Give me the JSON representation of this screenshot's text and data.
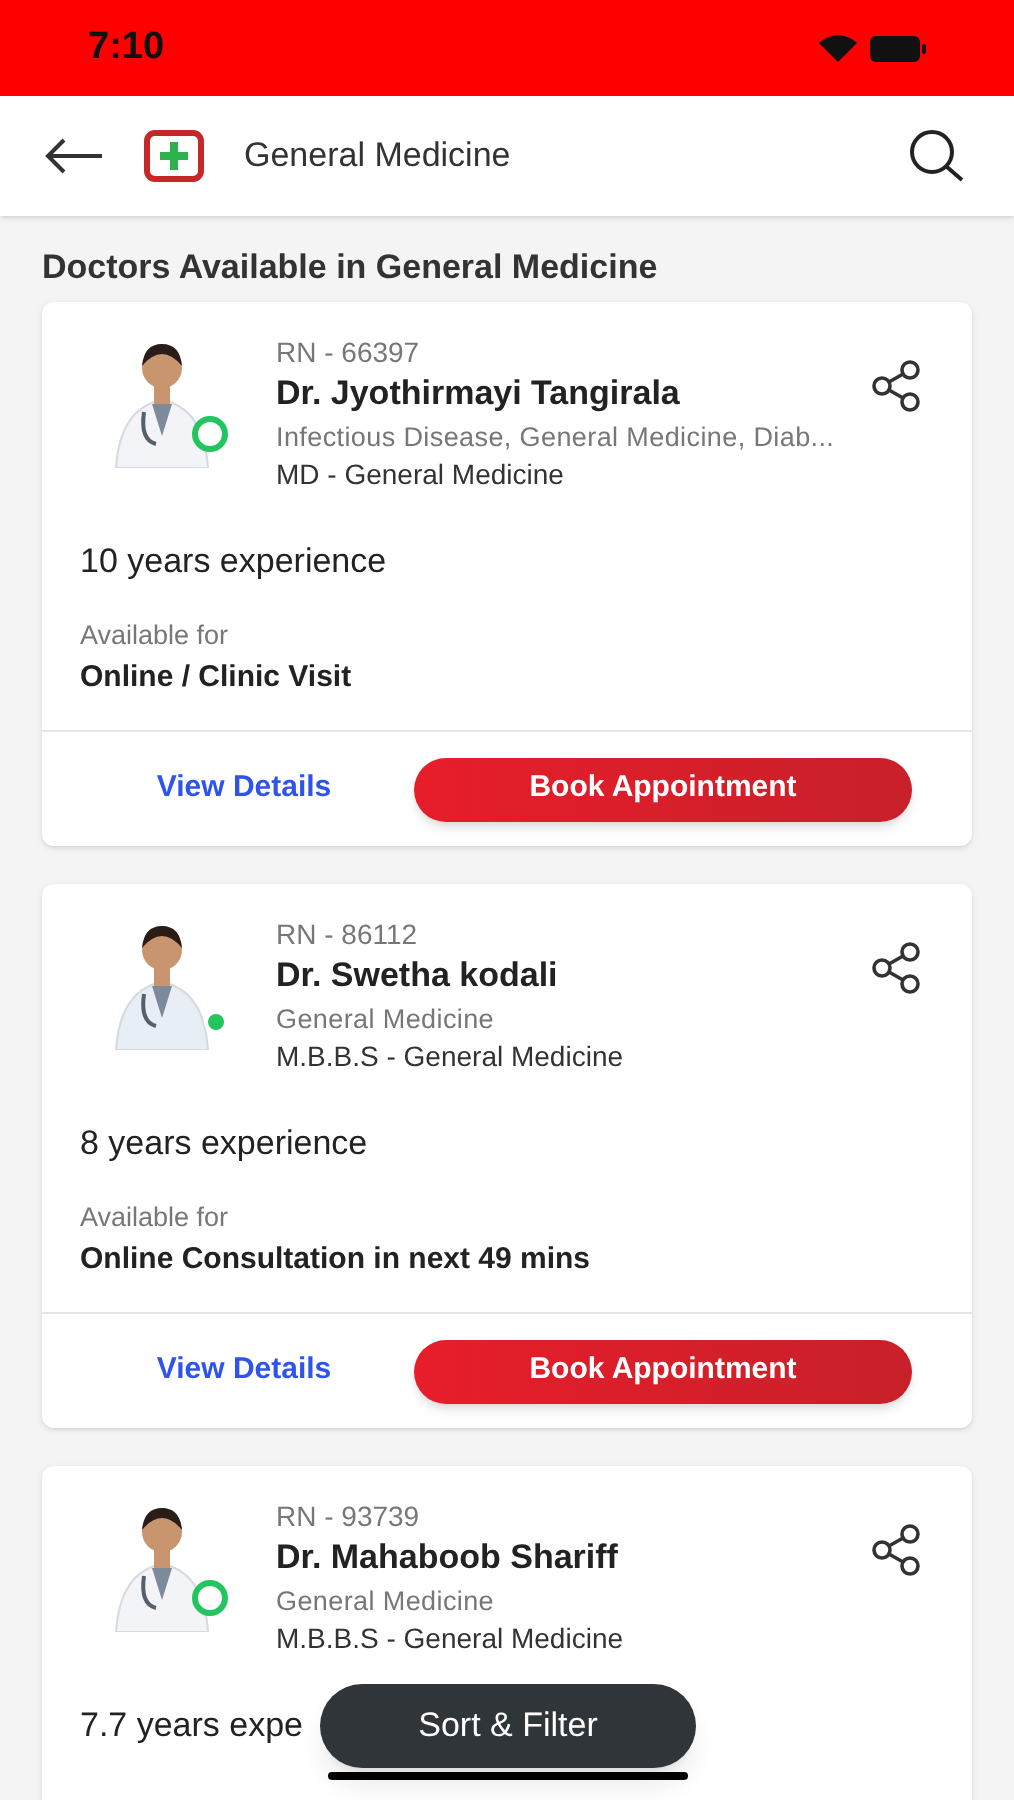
{
  "status_bar": {
    "time": "7:10"
  },
  "header": {
    "title": "General Medicine"
  },
  "section_title": "Doctors Available in General Medicine",
  "doctors": [
    {
      "rn": "RN - 66397",
      "name": "Dr. Jyothirmayi Tangirala",
      "specialities": "Infectious Disease, General Medicine, Diab...",
      "degree": "MD - General Medicine",
      "experience": "10 years experience",
      "available_label": "Available for",
      "available": "Online / Clinic Visit",
      "indicator_filled": false,
      "view_label": "View Details",
      "book_label": "Book Appointment"
    },
    {
      "rn": "RN - 86112",
      "name": "Dr. Swetha kodali",
      "specialities": "General Medicine",
      "degree": "M.B.B.S - General Medicine",
      "experience": "8 years experience",
      "available_label": "Available for",
      "available": "Online Consultation in next 49 mins",
      "indicator_filled": true,
      "view_label": "View Details",
      "book_label": "Book Appointment"
    },
    {
      "rn": "RN - 93739",
      "name": "Dr. Mahaboob Shariff",
      "specialities": "General Medicine",
      "degree": "M.B.B.S - General Medicine",
      "experience": "7.7 years expe",
      "indicator_filled": false
    }
  ],
  "sort_filter": "Sort & Filter"
}
